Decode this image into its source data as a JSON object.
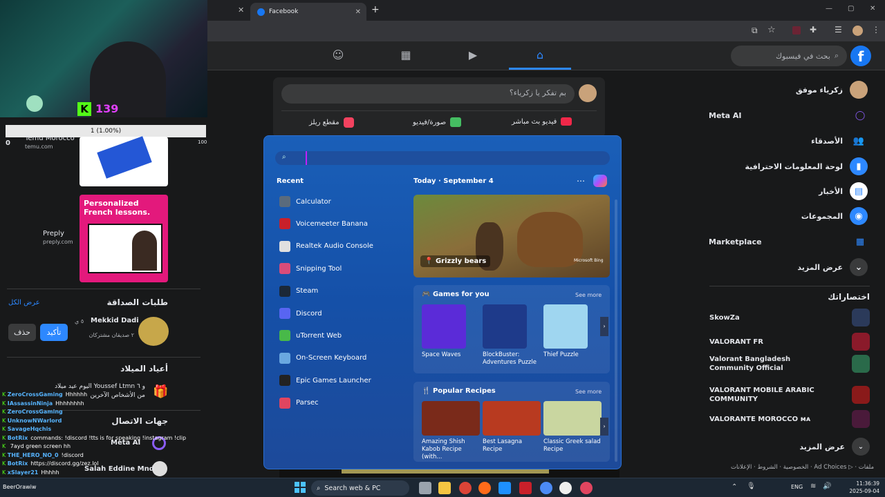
{
  "browser": {
    "tabs": [
      {
        "label": "Facebook"
      }
    ],
    "window_controls": [
      "—",
      "▢",
      "✕"
    ]
  },
  "facebook": {
    "search_placeholder": "بحث في فيسبوك",
    "composer_placeholder": "بم تفكر يا زكرياء؟",
    "composer_actions": [
      {
        "label": "فيديو بث مباشر",
        "color": "#f02849"
      },
      {
        "label": "صورة/فيديو",
        "color": "#45bd62"
      },
      {
        "label": "مقطع ريلز",
        "color": "#f3425f"
      }
    ],
    "right_nav": [
      {
        "label": "زكرياء موفق"
      },
      {
        "label": "Meta AI"
      },
      {
        "label": "الأصدقاء"
      },
      {
        "label": "لوحة المعلومات الاحترافية"
      },
      {
        "label": "الأخبار"
      },
      {
        "label": "المجموعات"
      },
      {
        "label": "Marketplace"
      },
      {
        "label": "عرض المزيد"
      }
    ],
    "shortcuts_title": "اختصاراتك",
    "shortcuts": [
      {
        "label": "SkowZa"
      },
      {
        "label": "VALORANT FR"
      },
      {
        "label": "Valorant Bangladesh Community Official"
      },
      {
        "label": "VALORANT MOBILE ARABIC COMMUNITY"
      },
      {
        "label": "VALORANTE MOROCCO ᴍᴀ"
      }
    ],
    "shortcuts_more": "عرض المزيد",
    "footer": "الخصوصية · الشروط · الإعلانات · Ad Choices ▷ · ملفات",
    "left": {
      "ads": [
        {
          "name": "Temu Morocco",
          "url": "temu.com"
        },
        {
          "name": "Preply",
          "url": "preply.com",
          "image_text": "Personalized French lessons."
        }
      ],
      "friend_requests_title": "طلبات الصداقة",
      "see_all": "عرض الكل",
      "request": {
        "name": "Mekkid Dadi",
        "time": "٥ ي",
        "mutual": "٢ صديقان مشتركان",
        "confirm": "تأكيد",
        "delete": "حذف"
      },
      "birthdays_title": "أعياد الميلاد",
      "birthday_text": "اليوم عيد ميلاد Youssef Ltmn و ٦ من الأشخاص الآخرين",
      "contacts_title": "جهات الاتصال",
      "contacts": [
        {
          "label": "Meta AI"
        },
        {
          "label": "Salah Eddine Mnd"
        }
      ]
    }
  },
  "stream_overlay": {
    "kick_count": "139",
    "goal_text": "1 (1.00%)",
    "goal_min": "0",
    "goal_max": "100",
    "chat": [
      {
        "user": "ZeroCrossGaming",
        "msg": "Hhhhhh"
      },
      {
        "user": "IAssassinNinja",
        "msg": "Hhhhhhhh"
      },
      {
        "user": "ZeroCrossGaming",
        "msg": ""
      },
      {
        "user": "UnknowNWarlord",
        "msg": ""
      },
      {
        "user": "SavageHqchis",
        "msg": ""
      },
      {
        "user": "BotRix",
        "msg": "commands: !discord !tts is for speaking !instagram !clip"
      },
      {
        "user": "",
        "msg": "7ayd green screen hh"
      },
      {
        "user": "THE_HERO_NO_0",
        "msg": "!discord"
      },
      {
        "user": "BotRix",
        "msg": "https://discord.gg/zez.lol"
      },
      {
        "user": "xSlayer21",
        "msg": "Hhhhh"
      }
    ]
  },
  "start_menu": {
    "recent_title": "Recent",
    "recent": [
      {
        "label": "Calculator",
        "color": "#5a6b7d"
      },
      {
        "label": "Voicemeeter Banana",
        "color": "#c8202a"
      },
      {
        "label": "Realtek Audio Console",
        "color": "#e0e0e0"
      },
      {
        "label": "Snipping Tool",
        "color": "#d94c7a"
      },
      {
        "label": "Steam",
        "color": "#1b2838"
      },
      {
        "label": "Discord",
        "color": "#5865f2"
      },
      {
        "label": "uTorrent Web",
        "color": "#48b949"
      },
      {
        "label": "On-Screen Keyboard",
        "color": "#6aa8e0"
      },
      {
        "label": "Epic Games Launcher",
        "color": "#222"
      },
      {
        "label": "Parsec",
        "color": "#e04560"
      }
    ],
    "date_label": "Today",
    "date": "September 4",
    "hero_caption": "Grizzly bears",
    "hero_brand": "Microsoft Bing",
    "games_title": "Games for you",
    "games_see_more": "See more",
    "games": [
      {
        "label": "Space Waves",
        "color": "#5b2bd8"
      },
      {
        "label": "BlockBuster: Adventures Puzzle",
        "color": "#1e3a8a"
      },
      {
        "label": "Thief Puzzle",
        "color": "#9fd6f0"
      }
    ],
    "recipes_title": "Popular Recipes",
    "recipes_see_more": "See more",
    "recipes": [
      {
        "label": "Amazing Shish Kabob Recipe (with...",
        "color": "#7a2a1a"
      },
      {
        "label": "Best Lasagna Recipe",
        "color": "#b83a20"
      },
      {
        "label": "Classic Greek salad Recipe",
        "color": "#c9d6a0"
      }
    ]
  },
  "taskbar": {
    "search_label": "Search web & PC",
    "lang": "ENG",
    "time": "11:36:39",
    "date": "2025-09-04",
    "bottom_chat": "BeerOrawiw"
  }
}
